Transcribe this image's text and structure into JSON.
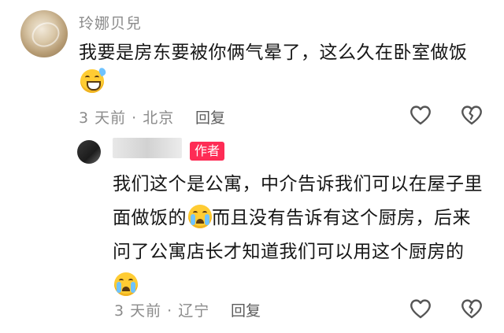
{
  "comment": {
    "username": "玲娜贝兒",
    "text": "我要是房东要被你俩气晕了，这么久在卧室做饭",
    "text_emoji": "grinning-sweat-emoji",
    "meta": "3 天前 · 北京",
    "reply_label": "回复",
    "like_icon": "heart-outline-icon",
    "dislike_icon": "broken-heart-icon"
  },
  "reply": {
    "author_badge": "作者",
    "text_part1": "我们这个是公寓，中介告诉我们可以在屋子里面做饭的",
    "text_part2": "而且没有告诉有这个厨房，后来问了公寓店长才知道我们可以用这个厨房的",
    "emoji": "crying-emoji",
    "meta": "3 天前 · 辽宁",
    "reply_label": "回复",
    "like_icon": "heart-outline-icon",
    "dislike_icon": "broken-heart-icon",
    "badge_color": "#fe2c55"
  }
}
